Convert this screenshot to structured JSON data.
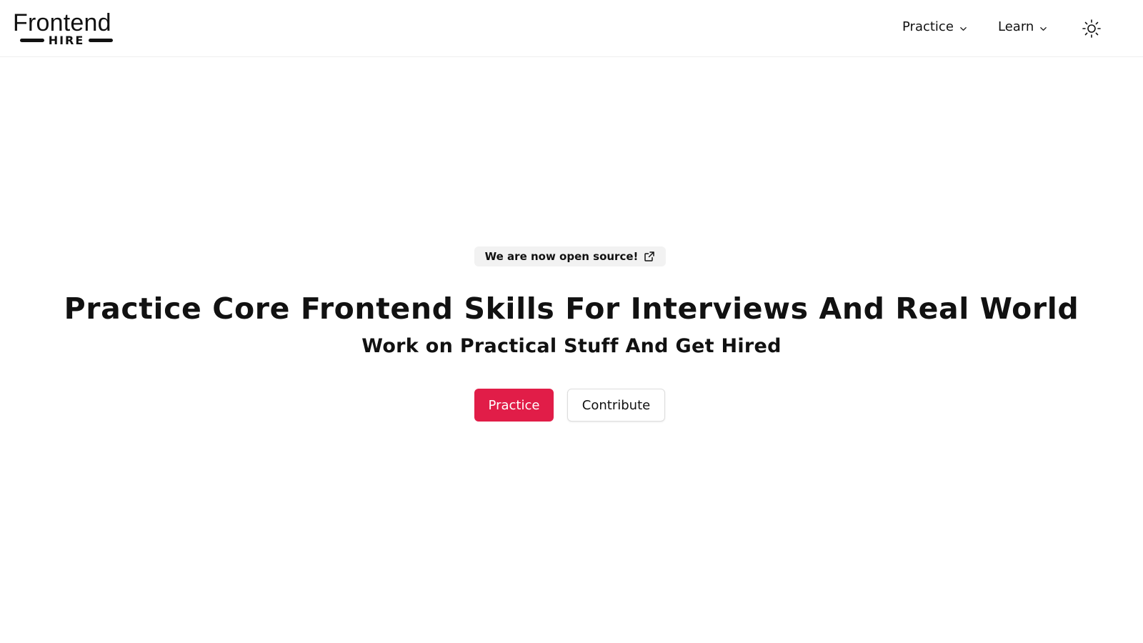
{
  "brand": {
    "name_top": "Frontend",
    "name_bottom": "HIRE"
  },
  "nav": {
    "items": [
      {
        "label": "Practice",
        "icon": "chevron-down-icon"
      },
      {
        "label": "Learn",
        "icon": "chevron-down-icon"
      }
    ],
    "theme_toggle_icon": "sun-icon"
  },
  "hero": {
    "badge": {
      "label": "We are now open source!",
      "icon": "external-link-icon"
    },
    "title": "Practice Core Frontend Skills For Interviews And Real World",
    "subtitle": "Work on Practical Stuff And Get Hired",
    "primary_button": "Practice",
    "secondary_button": "Contribute"
  },
  "colors": {
    "accent": "#e11d48",
    "text": "#111111",
    "badge_bg": "#f2f2f2"
  }
}
